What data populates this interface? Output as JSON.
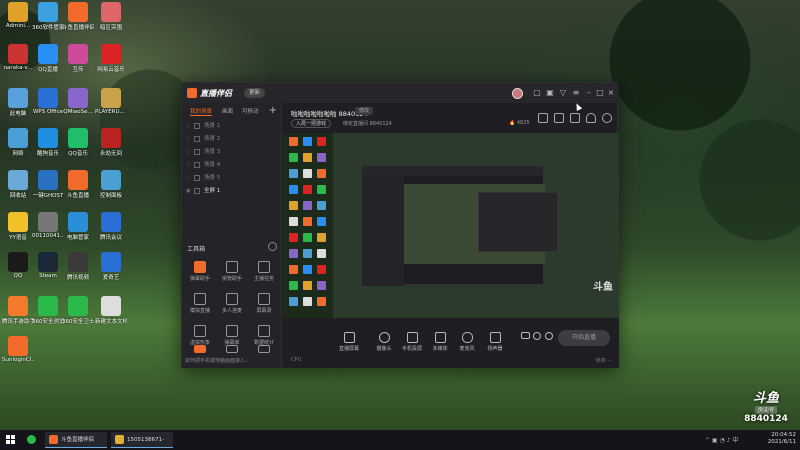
{
  "desktop": {
    "icons": [
      {
        "label": "Admini...",
        "color": "#e0a12b"
      },
      {
        "label": "360软件管家",
        "color": "#3aa0e0"
      },
      {
        "label": "斗鱼直播伴侣",
        "color": "#f26b2a"
      },
      {
        "label": "暗区突围",
        "color": "#d66"
      },
      {
        "label": "naraka-v...",
        "color": "#c33"
      },
      {
        "label": "QQ直播",
        "color": "#2a8ff2"
      },
      {
        "label": "互传",
        "color": "#cc4b9b"
      },
      {
        "label": "网易云音乐",
        "color": "#d22"
      },
      {
        "label": "此电脑",
        "color": "#5aa0dd"
      },
      {
        "label": "WPS Office",
        "color": "#2a6fd6"
      },
      {
        "label": "QMiaoSe...",
        "color": "#8866cc"
      },
      {
        "label": "PLAYERU... BATTLEG...",
        "color": "#c9a24a"
      },
      {
        "label": "网络",
        "color": "#4b9fd6"
      },
      {
        "label": "酷狗音乐",
        "color": "#1f8fe0"
      },
      {
        "label": "QQ音乐",
        "color": "#1fbf6a"
      },
      {
        "label": "永劫无间",
        "color": "#b22"
      },
      {
        "label": "回收站",
        "color": "#6aa8d8"
      },
      {
        "label": "一键GHOST",
        "color": "#2a70c0"
      },
      {
        "label": "斗鱼直播",
        "color": "#f26b2a"
      },
      {
        "label": "控制面板",
        "color": "#4aa0d0"
      },
      {
        "label": "YY语音",
        "color": "#f2c12a"
      },
      {
        "label": "00110041...",
        "color": "#777"
      },
      {
        "label": "电脑管家",
        "color": "#2a8fd6"
      },
      {
        "label": "腾讯会议",
        "color": "#2a6fd6"
      },
      {
        "label": "QQ",
        "color": "#1a1a1a"
      },
      {
        "label": "Steam",
        "color": "#1b2838"
      },
      {
        "label": "腾讯视频",
        "color": "#3a3a3a"
      },
      {
        "label": "爱奇艺",
        "color": "#2a6fd6"
      },
      {
        "label": "腾讯手游助手",
        "color": "#f27a2a"
      },
      {
        "label": "360安全浏览器",
        "color": "#2bb94a"
      },
      {
        "label": "360安全卫士",
        "color": "#2bb94a"
      },
      {
        "label": "新建文本文档",
        "color": "#ddd"
      },
      {
        "label": "SunloginCl...",
        "color": "#f26b2a"
      }
    ]
  },
  "app": {
    "name": "直播伴侣",
    "version_pill": "更新",
    "tabs": [
      "我的场景",
      "画面",
      "可移动"
    ],
    "scenes": [
      "场景 1",
      "场景 2",
      "场景 3",
      "场景 4",
      "场景 5",
      "全屏 1"
    ],
    "tools_header": "工具箱",
    "tools": [
      "弹幕助手",
      "房管助手",
      "主播任务",
      "模拟直播",
      "多人连麦",
      "屏幕录",
      "虚拟形象",
      "弹幕库",
      "数据统计",
      "",
      "",
      ""
    ],
    "bottom_link": "如何把手机或电脑画面接入...",
    "room_title": "啦啦啦啦啦啦啦 8840124",
    "edit_label": "修改",
    "category": "入局一把游戏",
    "room_info": "绑定直播间 8840124",
    "heat": "4825",
    "controls": [
      "直播屏幕",
      "摄像头",
      "手机投屏",
      "多媒体",
      "麦克风",
      "扬声器"
    ],
    "start_button": "开始直播",
    "status_left": "CPU",
    "status_right": "帧率 --"
  },
  "badge": {
    "logo": "斗鱼",
    "label": "房间号",
    "number": "8840124"
  },
  "taskbar": {
    "items": [
      {
        "label": "斗鱼直播伴侣",
        "color": "#f26b2a"
      },
      {
        "label": "1505138671-啊啊...",
        "color": "#e0b030"
      }
    ],
    "time": "20:04:52",
    "date": "2021/6/11"
  }
}
